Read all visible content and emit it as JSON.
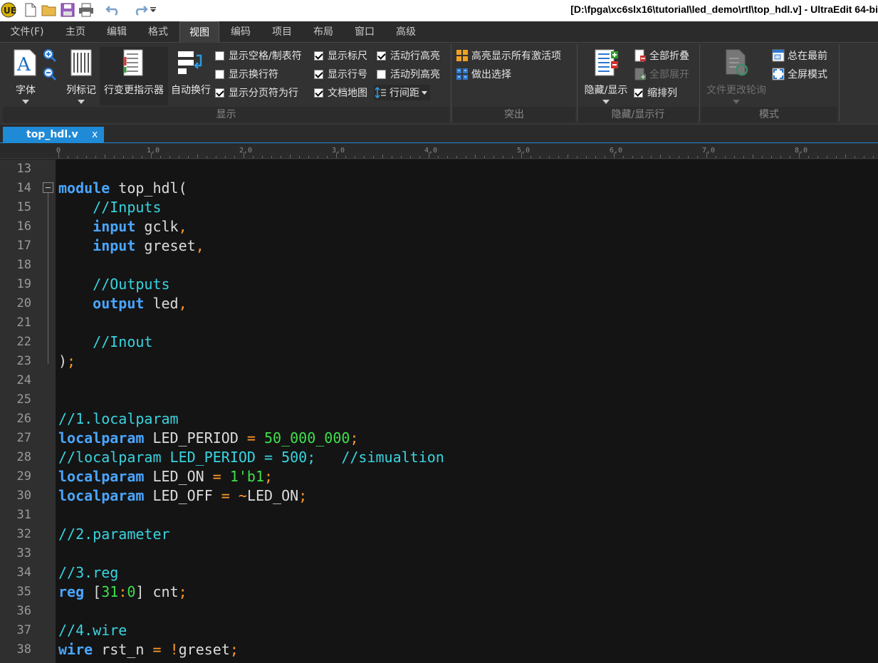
{
  "window": {
    "title": "[D:\\fpga\\xc6slx16\\tutorial\\led_demo\\rtl\\top_hdl.v] - UltraEdit 64-bi"
  },
  "menu": {
    "tabs": [
      "文件(F)",
      "主页",
      "编辑",
      "格式",
      "视图",
      "编码",
      "项目",
      "布局",
      "窗口",
      "高级"
    ],
    "active": "视图"
  },
  "ribbon": {
    "display": {
      "label": "显示",
      "font": "字体",
      "column_marker": "列标记",
      "change_indicator": "行变更指示器",
      "word_wrap": "自动换行",
      "checks": [
        {
          "label": "显示空格/制表符",
          "checked": false
        },
        {
          "label": "显示换行符",
          "checked": false
        },
        {
          "label": "显示分页符为行",
          "checked": true
        },
        {
          "label": "显示标尺",
          "checked": true
        },
        {
          "label": "显示行号",
          "checked": true
        },
        {
          "label": "文档地图",
          "checked": true
        },
        {
          "label": "活动行高亮",
          "checked": true
        },
        {
          "label": "活动列高亮",
          "checked": false
        }
      ],
      "line_spacing": "行间距"
    },
    "highlight": {
      "label": "突出",
      "highlight_all": "高亮显示所有激活项",
      "make_selection": "做出选择"
    },
    "hide_show": {
      "label": "隐藏/显示行",
      "hide_show": "隐藏/显示",
      "collapse_all": "全部折叠",
      "expand_all": "全部展开",
      "indent_cols": {
        "label": "缩排列",
        "checked": true
      }
    },
    "mode": {
      "label": "模式",
      "file_change_poll": "文件更改轮询",
      "always_on_top": "总在最前",
      "fullscreen": "全屏模式"
    }
  },
  "document_tab": {
    "name": "top_hdl.v",
    "close": "x"
  },
  "ruler": {
    "labels": [
      "0",
      "1,0",
      "2,0",
      "3,0",
      "4,0",
      "5,0",
      "6,0",
      "7,0",
      "8,0"
    ]
  },
  "editor": {
    "lines": [
      {
        "n": "13",
        "tokens": []
      },
      {
        "n": "14",
        "tokens": [
          [
            "kw",
            "module"
          ],
          [
            "id",
            " top_hdl("
          ]
        ]
      },
      {
        "n": "15",
        "tokens": [
          [
            "id",
            "    "
          ],
          [
            "cm",
            "//Inputs"
          ]
        ]
      },
      {
        "n": "16",
        "tokens": [
          [
            "id",
            "    "
          ],
          [
            "kw",
            "input"
          ],
          [
            "id",
            " gclk"
          ],
          [
            "pn",
            ","
          ]
        ]
      },
      {
        "n": "17",
        "tokens": [
          [
            "id",
            "    "
          ],
          [
            "kw",
            "input"
          ],
          [
            "id",
            " greset"
          ],
          [
            "pn",
            ","
          ]
        ]
      },
      {
        "n": "18",
        "tokens": []
      },
      {
        "n": "19",
        "tokens": [
          [
            "id",
            "    "
          ],
          [
            "cm",
            "//Outputs"
          ]
        ]
      },
      {
        "n": "20",
        "tokens": [
          [
            "id",
            "    "
          ],
          [
            "kw",
            "output"
          ],
          [
            "id",
            " led"
          ],
          [
            "pn",
            ","
          ]
        ]
      },
      {
        "n": "21",
        "tokens": []
      },
      {
        "n": "22",
        "tokens": [
          [
            "id",
            "    "
          ],
          [
            "cm",
            "//Inout"
          ]
        ]
      },
      {
        "n": "23",
        "tokens": [
          [
            "id",
            ")"
          ],
          [
            "pn",
            ";"
          ]
        ]
      },
      {
        "n": "24",
        "tokens": []
      },
      {
        "n": "25",
        "tokens": []
      },
      {
        "n": "26",
        "tokens": [
          [
            "cm",
            "//1.localparam"
          ]
        ]
      },
      {
        "n": "27",
        "tokens": [
          [
            "kw",
            "localparam"
          ],
          [
            "id",
            " LED_PERIOD "
          ],
          [
            "pn",
            "="
          ],
          [
            "id",
            " "
          ],
          [
            "nm",
            "50_000_000"
          ],
          [
            "pn",
            ";"
          ]
        ]
      },
      {
        "n": "28",
        "tokens": [
          [
            "cm",
            "//localparam LED_PERIOD = 500;   //simualtion"
          ]
        ]
      },
      {
        "n": "29",
        "tokens": [
          [
            "kw",
            "localparam"
          ],
          [
            "id",
            " LED_ON "
          ],
          [
            "pn",
            "="
          ],
          [
            "id",
            " "
          ],
          [
            "nm",
            "1'b1"
          ],
          [
            "pn",
            ";"
          ]
        ]
      },
      {
        "n": "30",
        "tokens": [
          [
            "kw",
            "localparam"
          ],
          [
            "id",
            " LED_OFF "
          ],
          [
            "pn",
            "="
          ],
          [
            "id",
            " "
          ],
          [
            "pn",
            "~"
          ],
          [
            "id",
            "LED_ON"
          ],
          [
            "pn",
            ";"
          ]
        ]
      },
      {
        "n": "31",
        "tokens": []
      },
      {
        "n": "32",
        "tokens": [
          [
            "cm",
            "//2.parameter"
          ]
        ]
      },
      {
        "n": "33",
        "tokens": []
      },
      {
        "n": "34",
        "tokens": [
          [
            "cm",
            "//3.reg"
          ]
        ]
      },
      {
        "n": "35",
        "tokens": [
          [
            "kw",
            "reg"
          ],
          [
            "id",
            " ["
          ],
          [
            "nm",
            "31"
          ],
          [
            "pn",
            ":"
          ],
          [
            "nm",
            "0"
          ],
          [
            "id",
            "] cnt"
          ],
          [
            "pn",
            ";"
          ]
        ]
      },
      {
        "n": "36",
        "tokens": []
      },
      {
        "n": "37",
        "tokens": [
          [
            "cm",
            "//4.wire"
          ]
        ]
      },
      {
        "n": "38",
        "tokens": [
          [
            "kw",
            "wire"
          ],
          [
            "id",
            " rst_n "
          ],
          [
            "pn",
            "="
          ],
          [
            "id",
            " "
          ],
          [
            "pn",
            "!"
          ],
          [
            "id",
            "greset"
          ],
          [
            "pn",
            ";"
          ]
        ]
      }
    ]
  },
  "colors": {
    "keyword": "#4aa6ff",
    "comment": "#39d4e0",
    "number": "#3fe04d",
    "punct": "#ff9a2e",
    "tab_accent": "#1f8ad6"
  }
}
